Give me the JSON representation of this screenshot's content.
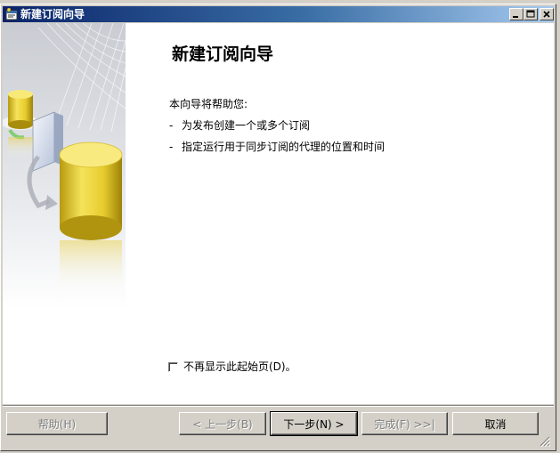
{
  "window": {
    "title": "新建订阅向导",
    "controls": {
      "minimize": "minimize-icon",
      "maximize": "maximize-icon",
      "close": "close-icon"
    }
  },
  "page": {
    "heading": "新建订阅向导",
    "intro": "本向导将帮助您:",
    "bullets": [
      {
        "dash": "-",
        "text": "为发布创建一个或多个订阅"
      },
      {
        "dash": "-",
        "text": "指定运行用于同步订阅的代理的位置和时间"
      }
    ],
    "checkbox": {
      "label": "不再显示此起始页(D)。",
      "checked": false
    }
  },
  "buttons": {
    "help": "帮助(H)",
    "back": "< 上一步(B)",
    "next": "下一步(N) >",
    "finish": "完成(F) >>|",
    "cancel": "取消"
  },
  "colors": {
    "titlebar_start": "#0a246a",
    "titlebar_end": "#a6caf0",
    "face": "#d4d0c8",
    "cylinder": "#f0d84a"
  }
}
